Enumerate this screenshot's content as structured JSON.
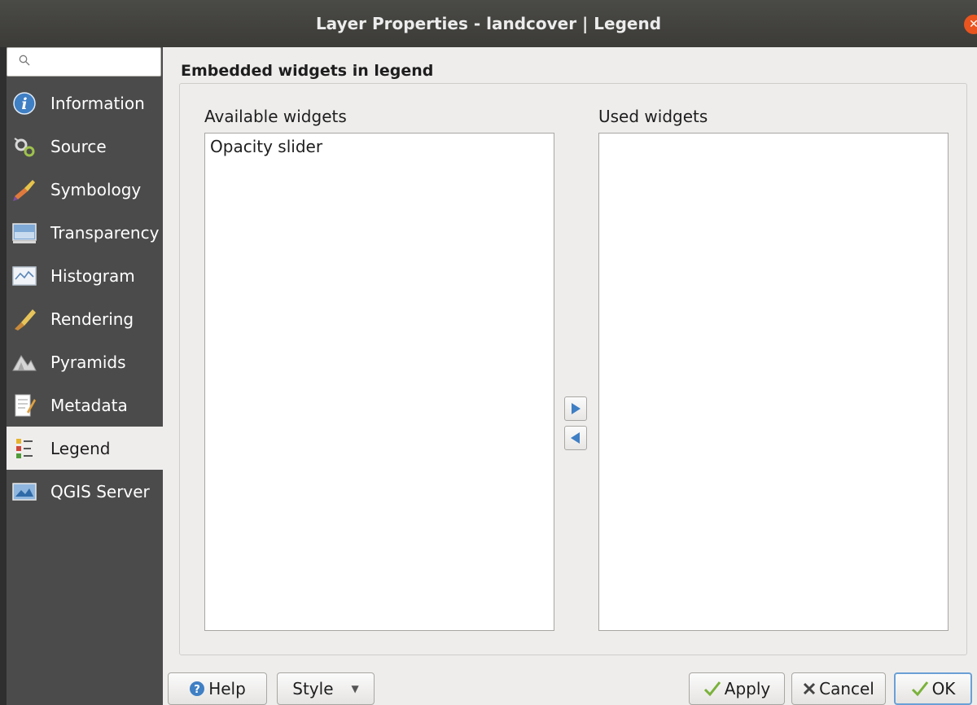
{
  "window": {
    "title": "Layer Properties - landcover | Legend",
    "close_glyph": "✕"
  },
  "search": {
    "placeholder": "",
    "value": ""
  },
  "sidebar": {
    "items": [
      {
        "label": "Information",
        "icon": "info-icon"
      },
      {
        "label": "Source",
        "icon": "source-icon"
      },
      {
        "label": "Symbology",
        "icon": "symbology-icon"
      },
      {
        "label": "Transparency",
        "icon": "transparency-icon"
      },
      {
        "label": "Histogram",
        "icon": "histogram-icon"
      },
      {
        "label": "Rendering",
        "icon": "rendering-icon"
      },
      {
        "label": "Pyramids",
        "icon": "pyramids-icon"
      },
      {
        "label": "Metadata",
        "icon": "metadata-icon"
      },
      {
        "label": "Legend",
        "icon": "legend-icon",
        "active": true
      },
      {
        "label": "QGIS Server",
        "icon": "qgis-server-icon"
      }
    ]
  },
  "main": {
    "section_title": "Embedded widgets in legend",
    "available": {
      "label": "Available widgets",
      "items": [
        "Opacity slider"
      ]
    },
    "used": {
      "label": "Used widgets",
      "items": []
    }
  },
  "buttons": {
    "help": "Help",
    "style": "Style",
    "apply": "Apply",
    "cancel": "Cancel",
    "ok": "OK"
  },
  "colors": {
    "sidebar_bg": "#4b4b4b",
    "window_bg": "#efedec",
    "accent_blue": "#3f7fc4",
    "close_orange": "#e9541f"
  }
}
